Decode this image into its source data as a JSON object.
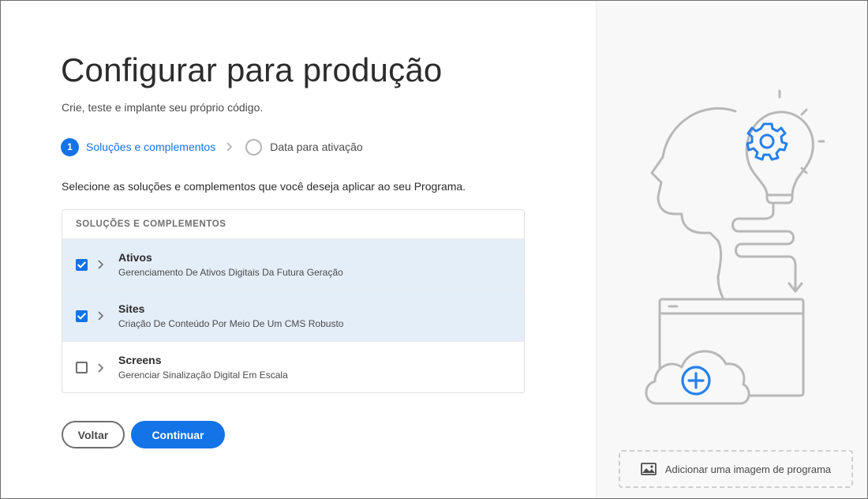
{
  "page": {
    "title": "Configurar para produção",
    "subtitle": "Crie, teste e implante seu próprio código."
  },
  "stepper": {
    "steps": [
      {
        "number": "1",
        "label": "Soluções e complementos",
        "state": "active"
      },
      {
        "number": "",
        "label": "Data para ativação",
        "state": "inactive"
      }
    ]
  },
  "instruction": "Selecione as soluções e complementos que você deseja aplicar ao seu Programa.",
  "solutions_table": {
    "header": "SOLUÇÕES E COMPLEMENTOS",
    "rows": [
      {
        "title": "Ativos",
        "description": "Gerenciamento De Ativos Digitais Da Futura Geração",
        "checked": true
      },
      {
        "title": "Sites",
        "description": "Criação De Conteúdo Por Meio De Um CMS Robusto",
        "checked": true
      },
      {
        "title": "Screens",
        "description": "Gerenciar Sinalização Digital Em Escala",
        "checked": false
      }
    ]
  },
  "buttons": {
    "back_label": "Voltar",
    "continue_label": "Continuar"
  },
  "side_panel": {
    "add_image_label": "Adicionar uma imagem de programa",
    "add_image_icon": "image-icon",
    "illustration_icons": [
      "head-icon",
      "lightbulb-icon",
      "gear-icon",
      "browser-window-icon",
      "cloud-add-icon"
    ]
  },
  "colors": {
    "accent": "#1473e6",
    "selected_row": "#e4eef8",
    "illustration_stroke": "#b8b8b8",
    "side_panel_bg": "#f8f8f8"
  }
}
